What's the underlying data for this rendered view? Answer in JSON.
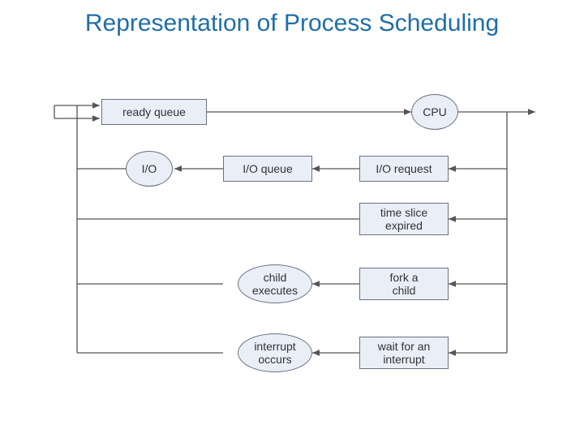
{
  "title": "Representation of Process Scheduling",
  "nodes": {
    "ready_queue": "ready queue",
    "cpu": "CPU",
    "io": "I/O",
    "io_queue": "I/O queue",
    "io_request": "I/O request",
    "time_slice": "time slice\nexpired",
    "child_exec": "child\nexecutes",
    "fork_child": "fork a\nchild",
    "interrupt_occurs": "interrupt\noccurs",
    "wait_interrupt": "wait for an\ninterrupt"
  },
  "colors": {
    "title": "#1f6ea8",
    "node_fill": "#e9eef7",
    "node_stroke": "#6b7280",
    "line": "#555555"
  },
  "flow_description": "Processes enter ready queue, go to CPU, then exit or loop back via: I/O request→I/O queue→I/O; time slice expired; fork a child→child executes; wait for an interrupt→interrupt occurs. All return to ready queue."
}
